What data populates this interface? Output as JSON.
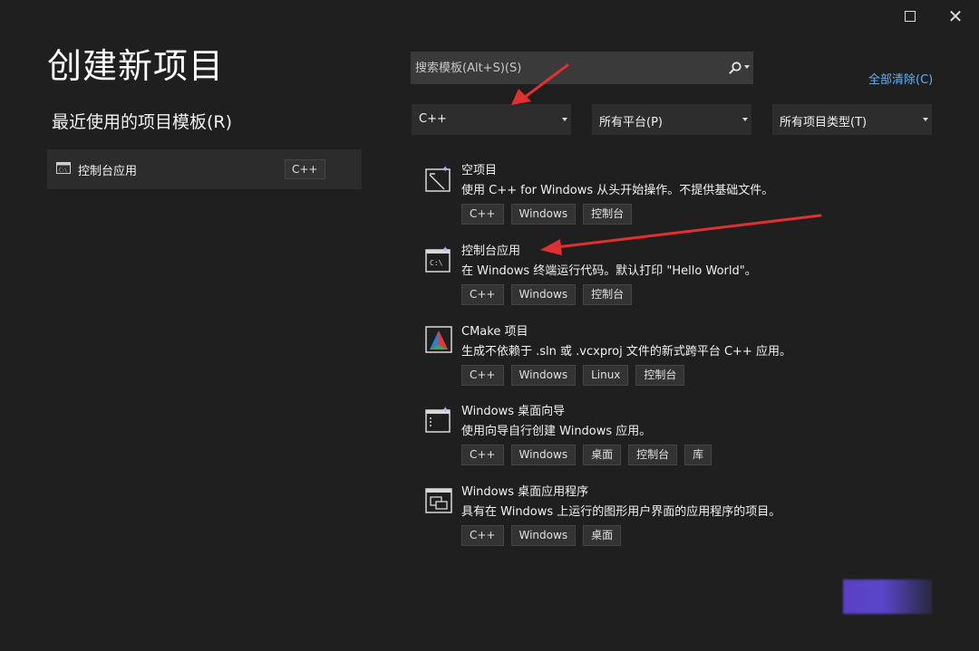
{
  "window": {
    "maximize_icon": "maximize-icon",
    "close_label": "✕"
  },
  "header": {
    "title": "创建新项目"
  },
  "recent": {
    "title": "最近使用的项目模板(R)",
    "items": [
      {
        "label": "控制台应用",
        "tag": "C++",
        "icon": "console-app-icon"
      }
    ]
  },
  "search": {
    "placeholder": "搜索模板(Alt+S)(S)",
    "value": "",
    "icon": "search-icon"
  },
  "clear_all": "全部清除(C)",
  "filters": [
    {
      "label": "C++"
    },
    {
      "label": "所有平台(P)"
    },
    {
      "label": "所有项目类型(T)"
    }
  ],
  "templates": [
    {
      "name": "空项目",
      "description": "使用 C++ for Windows 从头开始操作。不提供基础文件。",
      "tags": [
        "C++",
        "Windows",
        "控制台"
      ],
      "icon": "empty-project-icon"
    },
    {
      "name": "控制台应用",
      "description": "在 Windows 终端运行代码。默认打印 \"Hello World\"。",
      "tags": [
        "C++",
        "Windows",
        "控制台"
      ],
      "icon": "console-app-icon"
    },
    {
      "name": "CMake 项目",
      "description": "生成不依赖于 .sln 或 .vcxproj 文件的新式跨平台 C++ 应用。",
      "tags": [
        "C++",
        "Windows",
        "Linux",
        "控制台"
      ],
      "icon": "cmake-icon"
    },
    {
      "name": "Windows 桌面向导",
      "description": "使用向导自行创建 Windows 应用。",
      "tags": [
        "C++",
        "Windows",
        "桌面",
        "控制台",
        "库"
      ],
      "icon": "desktop-wizard-icon"
    },
    {
      "name": "Windows 桌面应用程序",
      "description": "具有在 Windows 上运行的图形用户界面的应用程序的项目。",
      "tags": [
        "C++",
        "Windows",
        "桌面"
      ],
      "icon": "desktop-app-icon"
    }
  ],
  "colors": {
    "background": "#1f1f1f",
    "link": "#5fb2f2",
    "annotation_arrow": "#e03030"
  }
}
